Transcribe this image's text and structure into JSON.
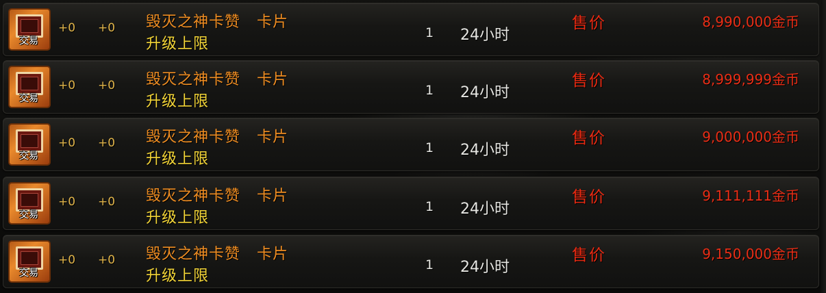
{
  "listings": [
    {
      "plus1": "+0",
      "plus2": "+0",
      "name": "毁灭之神卡赞   卡片",
      "sub": "升级上限",
      "qty": "1",
      "duration": "24小时",
      "price_label": "售价",
      "price": "8,990,000金币",
      "trade_badge": "交易",
      "icon": "card-item-icon"
    },
    {
      "plus1": "+0",
      "plus2": "+0",
      "name": "毁灭之神卡赞   卡片",
      "sub": "升级上限",
      "qty": "1",
      "duration": "24小时",
      "price_label": "售价",
      "price": "8,999,999金币",
      "trade_badge": "交易",
      "icon": "card-item-icon"
    },
    {
      "plus1": "+0",
      "plus2": "+0",
      "name": "毁灭之神卡赞   卡片",
      "sub": "升级上限",
      "qty": "1",
      "duration": "24小时",
      "price_label": "售价",
      "price": "9,000,000金币",
      "trade_badge": "交易",
      "icon": "card-item-icon"
    },
    {
      "plus1": "+0",
      "plus2": "+0",
      "name": "毁灭之神卡赞   卡片",
      "sub": "升级上限",
      "qty": "1",
      "duration": "24小时",
      "price_label": "售价",
      "price": "9,111,111金币",
      "trade_badge": "交易",
      "icon": "card-item-icon"
    },
    {
      "plus1": "+0",
      "plus2": "+0",
      "name": "毁灭之神卡赞   卡片",
      "sub": "升级上限",
      "qty": "1",
      "duration": "24小时",
      "price_label": "售价",
      "price": "9,150,000金币",
      "trade_badge": "交易",
      "icon": "card-item-icon"
    }
  ],
  "colors": {
    "name": "#ef8d22",
    "sub": "#f2d437",
    "price": "#e82a12",
    "plus": "#e0b44a",
    "text": "#e6e6e2"
  }
}
